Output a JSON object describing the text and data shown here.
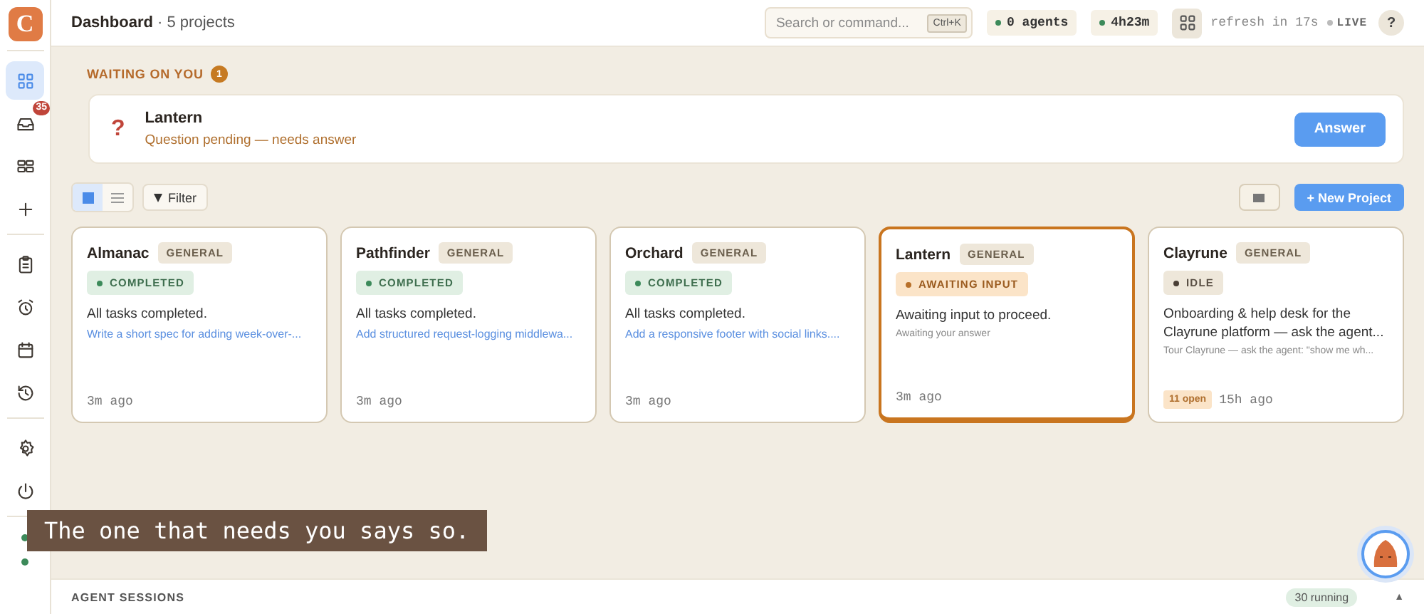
{
  "logo": {
    "letter": "C"
  },
  "header": {
    "title": "**Dashboard** · 5 projects",
    "search": {
      "placeholder": "Search or command...",
      "shortcut": "Ctrl+K"
    },
    "agents": "0 agents",
    "uptime": "4h23m",
    "refresh": "refresh in 17s",
    "live": "LIVE",
    "help": "?"
  },
  "sidebar": {
    "items": [
      {
        "selected": true
      },
      {
        "selected": false,
        "badge": "35"
      },
      {
        "selected": false
      },
      {
        "selected": false
      },
      {
        "selected": false
      },
      {
        "selected": false
      },
      {
        "selected": false
      },
      {
        "selected": false
      },
      {
        "selected": false
      },
      {
        "selected": false
      }
    ]
  },
  "waiting": {
    "title": "WAITING ON YOU",
    "count": "1",
    "item": {
      "mark": "?",
      "title": "Lantern",
      "message": "Question pending — needs answer",
      "button": "Answer"
    }
  },
  "toolbar": {
    "views": [
      {
        "selected": true
      },
      {
        "selected": false
      }
    ],
    "filter": "Filter",
    "new_project": "+ New Project"
  },
  "projects": [
    {
      "name": "Almanac",
      "tag": "GENERAL",
      "status": {
        "kind": "completed",
        "label": "COMPLETED"
      },
      "summary": "All tasks completed.",
      "detail": "Write a short spec for adding week-over-...",
      "time": "3m ago",
      "attention": false
    },
    {
      "name": "Pathfinder",
      "tag": "GENERAL",
      "status": {
        "kind": "completed",
        "label": "COMPLETED"
      },
      "summary": "All tasks completed.",
      "detail": "Add structured request-logging middlewa...",
      "time": "3m ago",
      "attention": false
    },
    {
      "name": "Orchard",
      "tag": "GENERAL",
      "status": {
        "kind": "completed",
        "label": "COMPLETED"
      },
      "summary": "All tasks completed.",
      "detail": "Add a responsive footer with social links....",
      "time": "3m ago",
      "attention": false
    },
    {
      "name": "Lantern",
      "tag": "GENERAL",
      "status": {
        "kind": "awaiting",
        "label": "AWAITING INPUT"
      },
      "summary": "Awaiting input to proceed.",
      "detail": "Awaiting your answer",
      "time": "3m ago",
      "attention": true
    },
    {
      "name": "Clayrune",
      "tag": "GENERAL",
      "status": {
        "kind": "idle",
        "label": "IDLE"
      },
      "summary": "Onboarding & help desk for the Clayrune platform — ask the agent...",
      "detail": "Tour Clayrune — ask the agent: \"show me wh...",
      "open": "11 open",
      "time": "15h ago",
      "attention": false
    }
  ],
  "caption": "The one that needs you says so.",
  "sessions": {
    "title": "AGENT SESSIONS",
    "running": "30 running",
    "toggle": "▲"
  }
}
